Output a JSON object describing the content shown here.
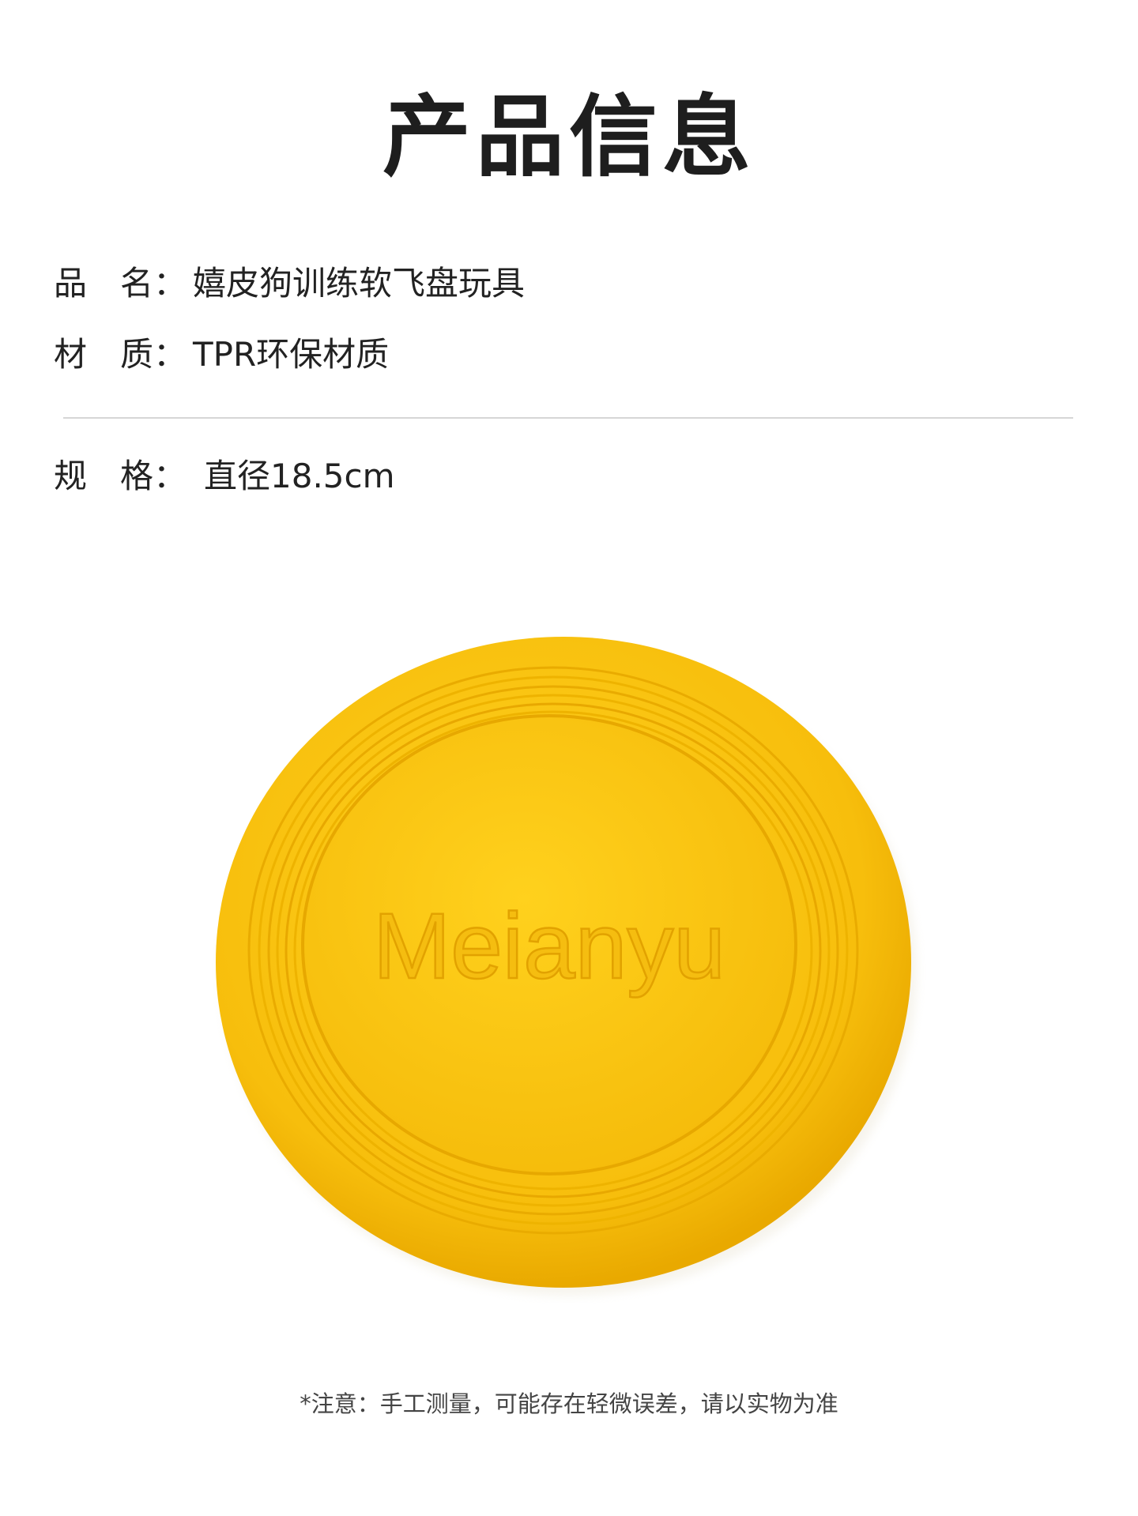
{
  "page": {
    "title": "产品信息"
  },
  "info": [
    {
      "label": "品　名：",
      "value": "嬉皮狗训练软飞盘玩具"
    },
    {
      "label": "材　质：",
      "value": "TPR环保材质"
    },
    {
      "label": "规　格：",
      "value": "直径18.5cm"
    }
  ],
  "product_image": {
    "brand_text": "Meianyu",
    "color": "#f7c10f"
  },
  "footnote": "*注意：手工测量，可能存在轻微误差，请以实物为准"
}
